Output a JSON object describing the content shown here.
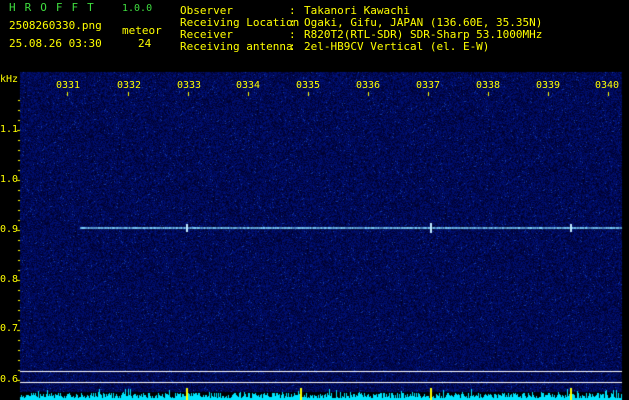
{
  "header": {
    "app_title": "HROFFT",
    "version": "1.0.0",
    "filename": "2508260330.png",
    "datetime": "25.08.26 03:30",
    "meteor_label": "meteor",
    "meteor_count": "24"
  },
  "info": [
    {
      "label": "Observer",
      "value": "Takanori Kawachi"
    },
    {
      "label": "Receiving Location",
      "value": "Ogaki, Gifu, JAPAN (136.60E, 35.35N)"
    },
    {
      "label": "Receiver",
      "value": "R820T2(RTL-SDR) SDR-Sharp 53.1000MHz"
    },
    {
      "label": "Receiving antenna",
      "value": "2el-HB9CV Vertical (el. E-W)"
    }
  ],
  "axis": {
    "y_unit": "kHz",
    "y_ticks": [
      "1.1",
      "1.0",
      "0.9",
      "0.8",
      "0.7",
      "0.6"
    ],
    "x_ticks": [
      "0331",
      "0332",
      "0333",
      "0334",
      "0335",
      "0336",
      "0337",
      "0338",
      "0339",
      "0340"
    ]
  },
  "colors": {
    "background": "#000000",
    "text": "#ffff00",
    "title": "#3fdc3f",
    "noise": "#0a1a6e",
    "signal": "#7fd6ff",
    "level_bars": "#00e5ff",
    "cursor_lines": "#ffffff"
  }
}
